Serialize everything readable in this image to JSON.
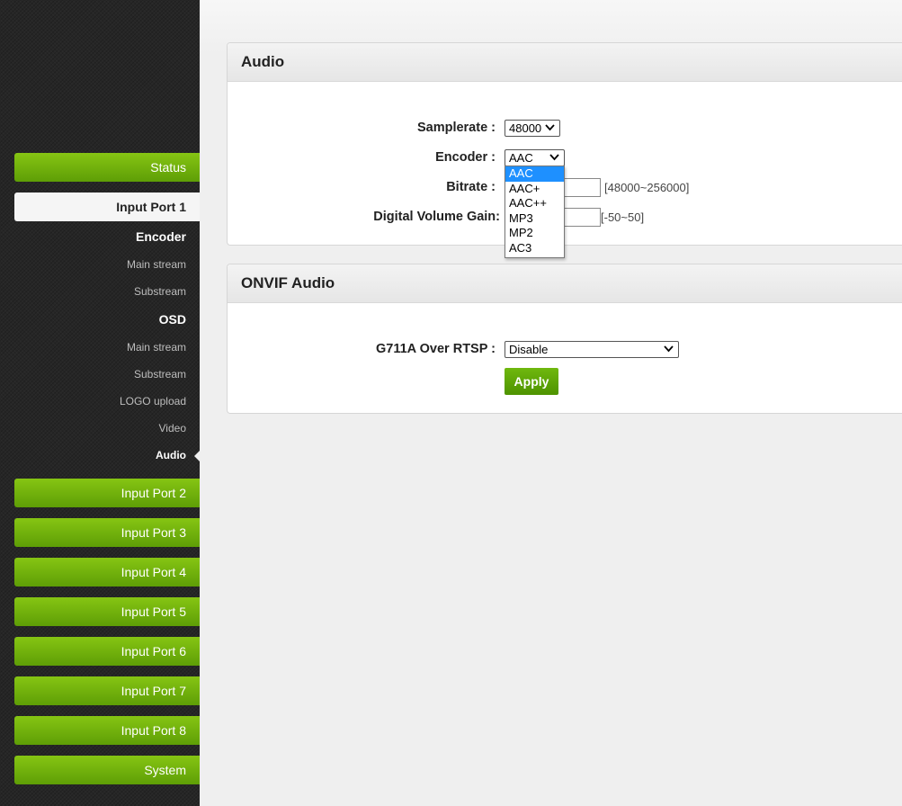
{
  "sidebar": {
    "status": "Status",
    "input_port_1": "Input Port 1",
    "encoder_heading": "Encoder",
    "encoder_items": [
      "Main stream",
      "Substream"
    ],
    "osd_heading": "OSD",
    "osd_items": [
      "Main stream",
      "Substream"
    ],
    "logo_upload": "LOGO upload",
    "video": "Video",
    "audio": "Audio",
    "input_ports": [
      "Input Port 2",
      "Input Port 3",
      "Input Port 4",
      "Input Port 5",
      "Input Port 6",
      "Input Port 7",
      "Input Port 8"
    ],
    "system": "System"
  },
  "audio_panel": {
    "title": "Audio",
    "samplerate_label": "Samplerate :",
    "samplerate_value": "48000",
    "encoder_label": "Encoder :",
    "encoder_value": "AAC",
    "encoder_options": [
      "AAC",
      "AAC+",
      "AAC++",
      "MP3",
      "MP2",
      "AC3"
    ],
    "bitrate_label": "Bitrate :",
    "bitrate_range": "[48000~256000]",
    "volume_label": "Digital Volume Gain:",
    "volume_range": "[-50~50]"
  },
  "onvif_panel": {
    "title": "ONVIF Audio",
    "g711a_label": "G711A Over RTSP :",
    "g711a_value": "Disable",
    "apply_label": "Apply"
  },
  "colors": {
    "accent_green": "#6fb80e",
    "sidebar_bg": "#262626",
    "highlight_blue": "#1e90ff"
  }
}
